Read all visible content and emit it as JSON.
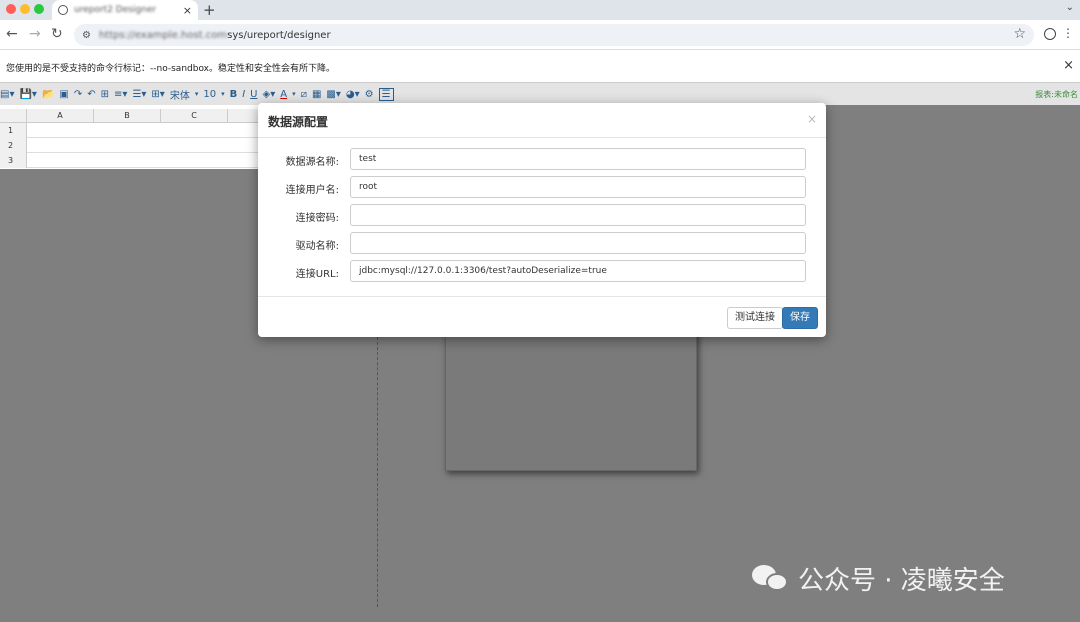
{
  "browser": {
    "tab_title": "ureport2 Designer",
    "tab_close": "×",
    "new_tab": "+",
    "url_host": "https://example.host.com",
    "url_path": "sys/ureport/designer",
    "info_message": "您使用的是不受支持的命令行标记：--no-sandbox。稳定性和安全性会有所下降。",
    "info_close": "×"
  },
  "toolbar": {
    "font_name": "宋体",
    "font_size": "10",
    "bold": "B",
    "italic": "I",
    "underline": "U",
    "font_color": "A",
    "right_text": "报表:未命名"
  },
  "grid": {
    "columns": [
      "A",
      "B",
      "C"
    ],
    "rows": [
      "1",
      "2",
      "3"
    ]
  },
  "modal": {
    "title": "数据源配置",
    "close": "×",
    "fields": [
      {
        "label": "数据源名称:",
        "value": "test"
      },
      {
        "label": "连接用户名:",
        "value": "root"
      },
      {
        "label": "连接密码:",
        "value": ""
      },
      {
        "label": "驱动名称:",
        "value": ""
      },
      {
        "label": "连接URL:",
        "value": "jdbc:mysql://127.0.0.1:3306/test?autoDeserialize=true"
      }
    ],
    "test_button": "测试连接",
    "save_button": "保存"
  },
  "watermark": {
    "text": "公众号 · 凌曦安全"
  },
  "colors": {
    "primary": "#337ab7",
    "workspace": "#7f7f7f"
  }
}
